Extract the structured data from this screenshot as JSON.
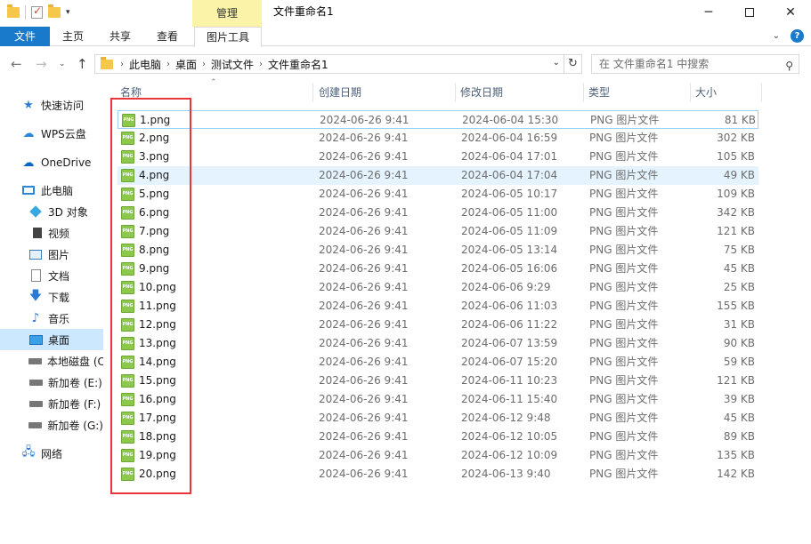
{
  "window": {
    "title": "文件重命名1",
    "context_tab_group": "管理",
    "minimize_glyph": "─",
    "close_glyph": "✕"
  },
  "ribbon": {
    "tabs": [
      "文件",
      "主页",
      "共享",
      "查看",
      "图片工具"
    ],
    "active_accent": "#1979ca"
  },
  "address": {
    "breadcrumbs": [
      "此电脑",
      "桌面",
      "测试文件",
      "文件重命名1"
    ],
    "search_placeholder": "在 文件重命名1 中搜索"
  },
  "sidebar": {
    "items": [
      {
        "label": "快速访问",
        "icon": "star-icon"
      },
      {
        "label": "WPS云盘",
        "icon": "cloud-icon"
      },
      {
        "label": "OneDrive",
        "icon": "onedrive-icon"
      },
      {
        "label": "此电脑",
        "icon": "pc-icon"
      },
      {
        "label": "3D 对象",
        "icon": "3d-objects-icon"
      },
      {
        "label": "视频",
        "icon": "video-icon"
      },
      {
        "label": "图片",
        "icon": "pictures-icon"
      },
      {
        "label": "文档",
        "icon": "documents-icon"
      },
      {
        "label": "下载",
        "icon": "download-icon"
      },
      {
        "label": "音乐",
        "icon": "music-icon"
      },
      {
        "label": "桌面",
        "icon": "desktop-icon",
        "selected": true
      },
      {
        "label": "本地磁盘 (C",
        "icon": "drive-icon"
      },
      {
        "label": "新加卷 (E:)",
        "icon": "drive-icon"
      },
      {
        "label": "新加卷 (F:)",
        "icon": "drive-icon"
      },
      {
        "label": "新加卷 (G:)",
        "icon": "drive-icon"
      },
      {
        "label": "网络",
        "icon": "network-icon"
      }
    ]
  },
  "columns": {
    "name": "名称",
    "created": "创建日期",
    "modified": "修改日期",
    "type": "类型",
    "size": "大小"
  },
  "files": [
    {
      "name": "1.png",
      "created": "2024-06-26 9:41",
      "modified": "2024-06-04 15:30",
      "type": "PNG 图片文件",
      "size": "81 KB"
    },
    {
      "name": "2.png",
      "created": "2024-06-26 9:41",
      "modified": "2024-06-04 16:59",
      "type": "PNG 图片文件",
      "size": "302 KB"
    },
    {
      "name": "3.png",
      "created": "2024-06-26 9:41",
      "modified": "2024-06-04 17:01",
      "type": "PNG 图片文件",
      "size": "105 KB"
    },
    {
      "name": "4.png",
      "created": "2024-06-26 9:41",
      "modified": "2024-06-04 17:04",
      "type": "PNG 图片文件",
      "size": "49 KB"
    },
    {
      "name": "5.png",
      "created": "2024-06-26 9:41",
      "modified": "2024-06-05 10:17",
      "type": "PNG 图片文件",
      "size": "109 KB"
    },
    {
      "name": "6.png",
      "created": "2024-06-26 9:41",
      "modified": "2024-06-05 11:00",
      "type": "PNG 图片文件",
      "size": "342 KB"
    },
    {
      "name": "7.png",
      "created": "2024-06-26 9:41",
      "modified": "2024-06-05 11:09",
      "type": "PNG 图片文件",
      "size": "121 KB"
    },
    {
      "name": "8.png",
      "created": "2024-06-26 9:41",
      "modified": "2024-06-05 13:14",
      "type": "PNG 图片文件",
      "size": "75 KB"
    },
    {
      "name": "9.png",
      "created": "2024-06-26 9:41",
      "modified": "2024-06-05 16:06",
      "type": "PNG 图片文件",
      "size": "45 KB"
    },
    {
      "name": "10.png",
      "created": "2024-06-26 9:41",
      "modified": "2024-06-06 9:29",
      "type": "PNG 图片文件",
      "size": "25 KB"
    },
    {
      "name": "11.png",
      "created": "2024-06-26 9:41",
      "modified": "2024-06-06 11:03",
      "type": "PNG 图片文件",
      "size": "155 KB"
    },
    {
      "name": "12.png",
      "created": "2024-06-26 9:41",
      "modified": "2024-06-06 11:22",
      "type": "PNG 图片文件",
      "size": "31 KB"
    },
    {
      "name": "13.png",
      "created": "2024-06-26 9:41",
      "modified": "2024-06-07 13:59",
      "type": "PNG 图片文件",
      "size": "90 KB"
    },
    {
      "name": "14.png",
      "created": "2024-06-26 9:41",
      "modified": "2024-06-07 15:20",
      "type": "PNG 图片文件",
      "size": "59 KB"
    },
    {
      "name": "15.png",
      "created": "2024-06-26 9:41",
      "modified": "2024-06-11 10:23",
      "type": "PNG 图片文件",
      "size": "121 KB"
    },
    {
      "name": "16.png",
      "created": "2024-06-26 9:41",
      "modified": "2024-06-11 15:40",
      "type": "PNG 图片文件",
      "size": "39 KB"
    },
    {
      "name": "17.png",
      "created": "2024-06-26 9:41",
      "modified": "2024-06-12 9:48",
      "type": "PNG 图片文件",
      "size": "45 KB"
    },
    {
      "name": "18.png",
      "created": "2024-06-26 9:41",
      "modified": "2024-06-12 10:05",
      "type": "PNG 图片文件",
      "size": "89 KB"
    },
    {
      "name": "19.png",
      "created": "2024-06-26 9:41",
      "modified": "2024-06-12 10:09",
      "type": "PNG 图片文件",
      "size": "135 KB"
    },
    {
      "name": "20.png",
      "created": "2024-06-26 9:41",
      "modified": "2024-06-13 9:40",
      "type": "PNG 图片文件",
      "size": "142 KB"
    }
  ],
  "file_icon_label": "PNG",
  "highlight_color": "#e8363a"
}
